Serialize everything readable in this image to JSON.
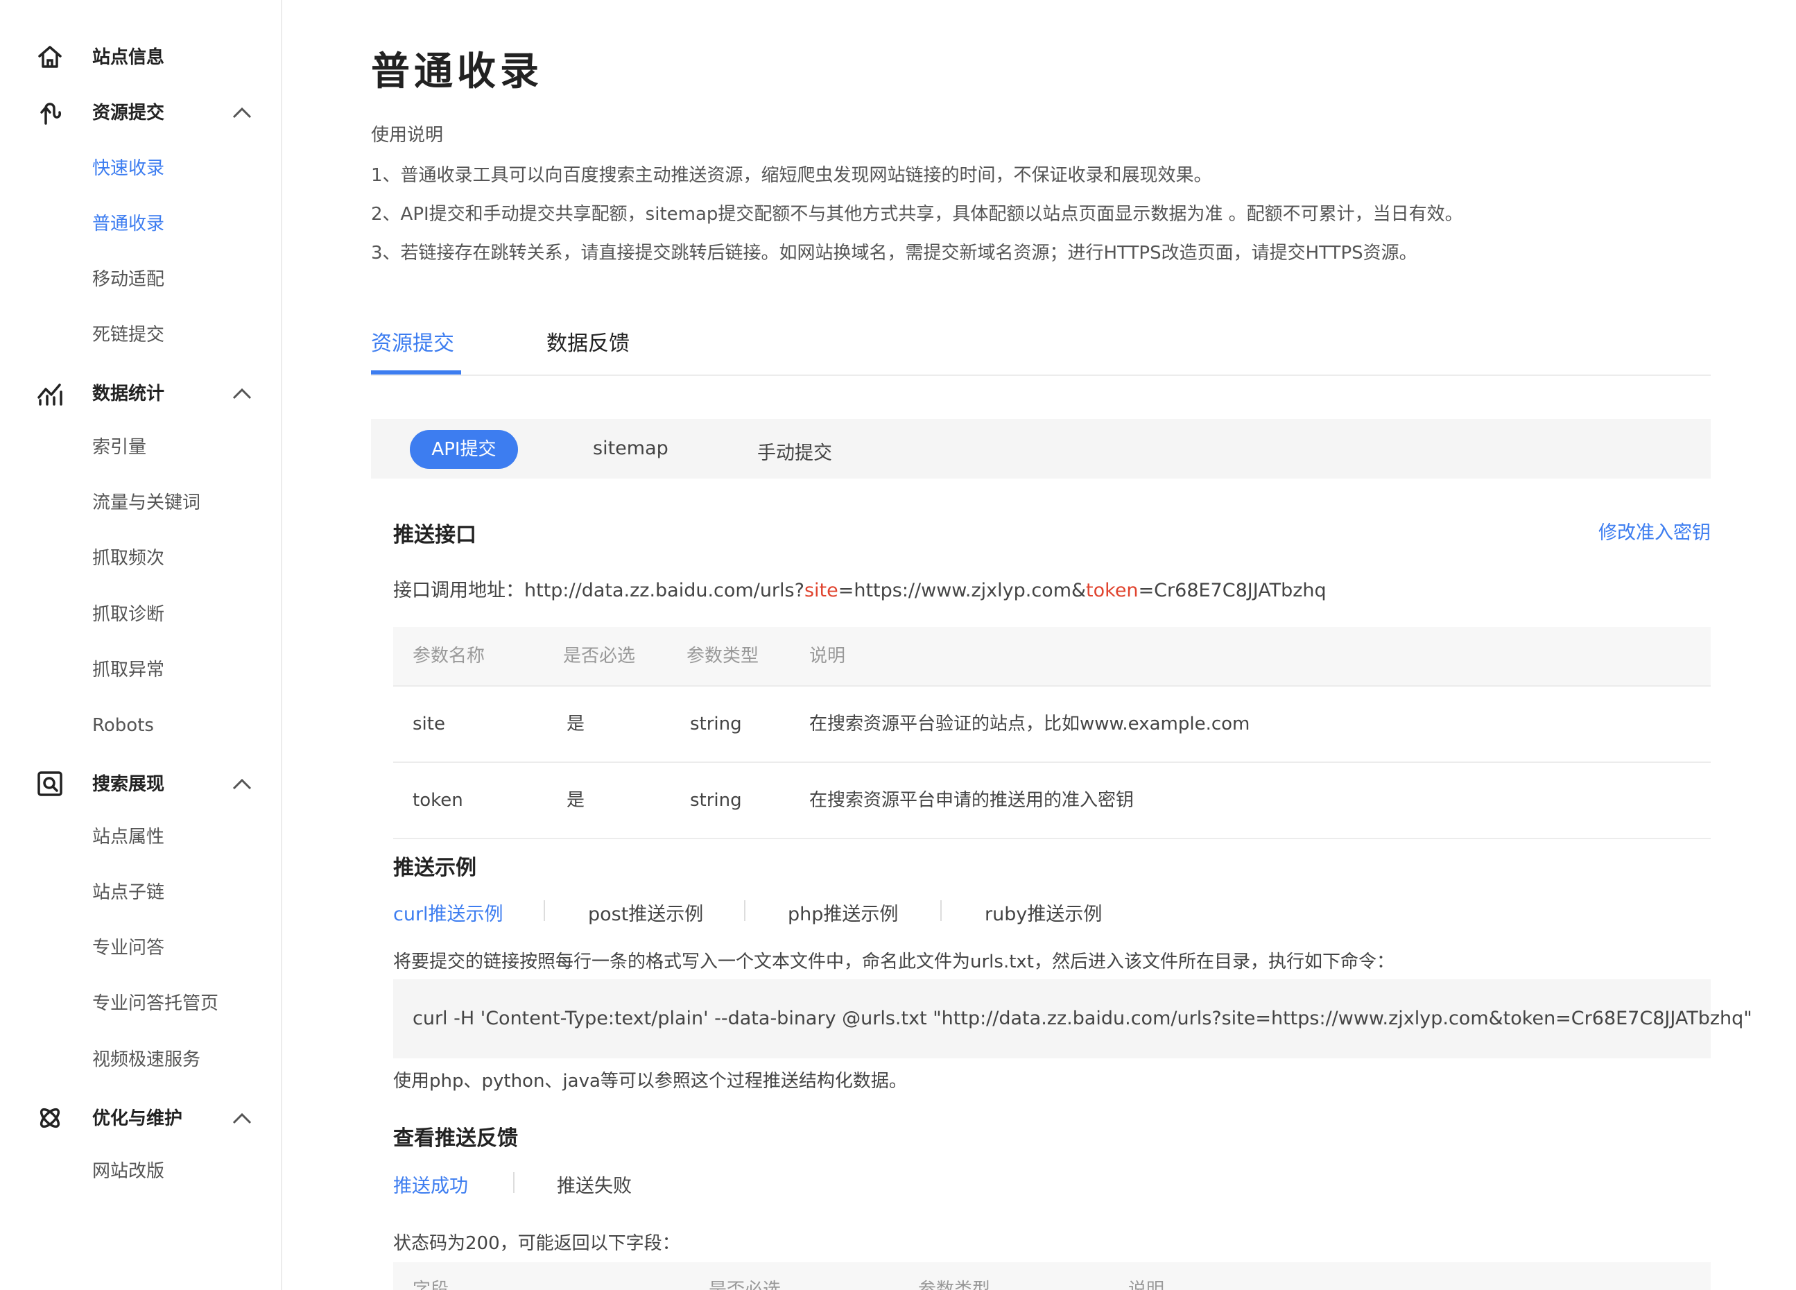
{
  "sidebar": {
    "groups": [
      {
        "label": "站点信息",
        "icon": "home-icon"
      },
      {
        "label": "资源提交",
        "icon": "submit-icon",
        "items": [
          "快速收录",
          "普通收录",
          "移动适配",
          "死链提交"
        ]
      },
      {
        "label": "数据统计",
        "icon": "stats-icon",
        "items": [
          "索引量",
          "流量与关键词",
          "抓取频次",
          "抓取诊断",
          "抓取异常",
          "Robots"
        ]
      },
      {
        "label": "搜索展现",
        "icon": "search-display-icon",
        "items": [
          "站点属性",
          "站点子链",
          "专业问答",
          "专业问答托管页",
          "视频极速服务"
        ]
      },
      {
        "label": "优化与维护",
        "icon": "optimize-icon",
        "items": [
          "网站改版"
        ]
      }
    ]
  },
  "page": {
    "title": "普通收录",
    "usage_heading": "使用说明",
    "usage_lines": [
      "1、普通收录工具可以向百度搜索主动推送资源，缩短爬虫发现网站链接的时间，不保证收录和展现效果。",
      "2、API提交和手动提交共享配额，sitemap提交配额不与其他方式共享，具体配额以站点页面显示数据为准 。配额不可累计，当日有效。",
      "3、若链接存在跳转关系，请直接提交跳转后链接。如网站换域名，需提交新域名资源；进行HTTPS改造页面，请提交HTTPS资源。"
    ],
    "tabs": [
      "资源提交",
      "数据反馈"
    ],
    "subtabs": [
      "API提交",
      "sitemap",
      "手动提交"
    ]
  },
  "push_api": {
    "heading": "推送接口",
    "modify_link": "修改准入密钥",
    "url_label": "接口调用地址：",
    "url_part1": "http://data.zz.baidu.com/urls?",
    "url_site_key": "site",
    "url_part2": "=https://www.zjxlyp.com&",
    "url_token_key": "token",
    "url_part3": "=Cr68E7C8JJATbzhq",
    "table_headers": [
      "参数名称",
      "是否必选",
      "参数类型",
      "说明"
    ],
    "rows": [
      [
        "site",
        "是",
        "string",
        "在搜索资源平台验证的站点，比如www.example.com"
      ],
      [
        "token",
        "是",
        "string",
        "在搜索资源平台申请的推送用的准入密钥"
      ]
    ]
  },
  "examples": {
    "heading": "推送示例",
    "tabs": [
      "curl推送示例",
      "post推送示例",
      "php推送示例",
      "ruby推送示例"
    ],
    "instruction": "将要提交的链接按照每行一条的格式写入一个文本文件中，命名此文件为urls.txt，然后进入该文件所在目录，执行如下命令：",
    "command": "curl -H 'Content-Type:text/plain' --data-binary @urls.txt \"http://data.zz.baidu.com/urls?site=https://www.zjxlyp.com&token=Cr68E7C8JJATbzhq\"",
    "note": "使用php、python、java等可以参照这个过程推送结构化数据。"
  },
  "feedback": {
    "heading": "查看推送反馈",
    "tabs": [
      "推送成功",
      "推送失败"
    ],
    "status_text": "状态码为200，可能返回以下字段：",
    "table_headers": [
      "字段",
      "是否必选",
      "参数类型",
      "说明"
    ]
  },
  "colors": {
    "accent": "#3d7df0",
    "highlight": "#e0442f"
  }
}
